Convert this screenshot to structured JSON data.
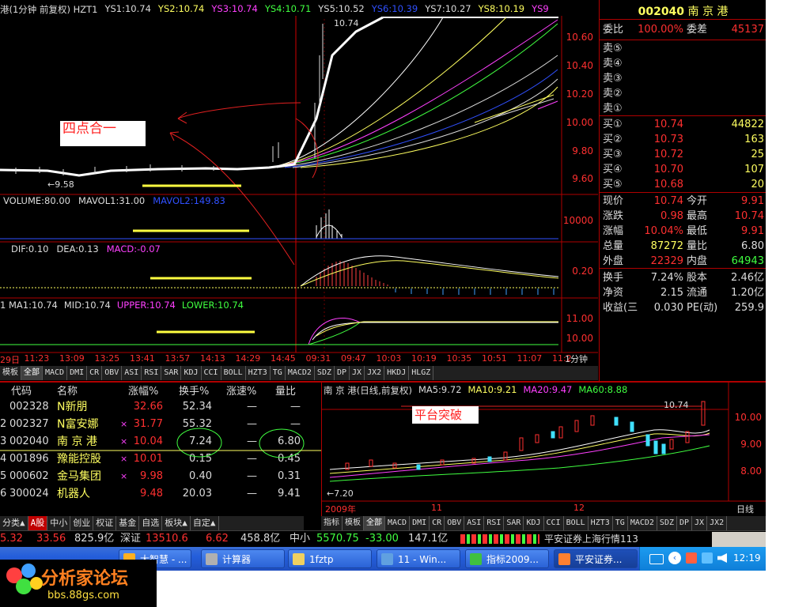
{
  "stock": {
    "code": "002040",
    "name": "南 京 港"
  },
  "intraday": {
    "legend": [
      {
        "text": "港(1分钟 前复权) HZT1",
        "color": "#dcdcdc"
      },
      {
        "text": "YS1:10.74",
        "color": "#dcdcdc"
      },
      {
        "text": "YS2:10.74",
        "color": "#ffff60"
      },
      {
        "text": "YS3:10.74",
        "color": "#ff40ff"
      },
      {
        "text": "YS4:10.71",
        "color": "#40ff40"
      },
      {
        "text": "YS5:10.52",
        "color": "#dcdcdc"
      },
      {
        "text": "YS6:10.39",
        "color": "#3050ff"
      },
      {
        "text": "YS7:10.27",
        "color": "#dcdcdc"
      },
      {
        "text": "YS8:10.19",
        "color": "#ffff60"
      },
      {
        "text": "YS9",
        "color": "#ff40ff"
      }
    ],
    "peak_label": "10.74",
    "low_label": "9.58",
    "annotation": "四点合一",
    "price_axis": [
      "10.60",
      "10.40",
      "10.20",
      "10.00",
      "9.80",
      "9.60"
    ]
  },
  "volume_panel": {
    "legend": [
      {
        "text": "VOLUME:80.00",
        "color": "#dcdcdc"
      },
      {
        "text": "MAVOL1:31.00",
        "color": "#dcdcdc"
      },
      {
        "text": "MAVOL2:149.83",
        "color": "#3050ff"
      }
    ],
    "axis": [
      "10000"
    ]
  },
  "macd_panel": {
    "legend": [
      {
        "text": "DIF:0.10",
        "color": "#dcdcdc"
      },
      {
        "text": "DEA:0.13",
        "color": "#dcdcdc"
      },
      {
        "text": "MACD:-0.07",
        "color": "#ff40ff"
      }
    ],
    "axis": [
      "0.20"
    ]
  },
  "boll_panel": {
    "legend": [
      {
        "text": "1 MA1:10.74",
        "color": "#dcdcdc"
      },
      {
        "text": "MID:10.74",
        "color": "#dcdcdc"
      },
      {
        "text": "UPPER:10.74",
        "color": "#ff40ff"
      },
      {
        "text": "LOWER:10.74",
        "color": "#40ff40"
      }
    ],
    "axis": [
      "11.00",
      "10.00"
    ]
  },
  "time_axis": {
    "labels": [
      "29日",
      "11:23",
      "13:09",
      "13:25",
      "13:41",
      "13:57",
      "14:13",
      "14:29",
      "14:45",
      "09:31",
      "09:47",
      "10:03",
      "10:19",
      "10:35",
      "10:51",
      "11:07",
      "11:2"
    ],
    "period": "1分钟"
  },
  "indicator_tabs_top": [
    "模板",
    "全部",
    "MACD",
    "DMI",
    "CR",
    "OBV",
    "ASI",
    "RSI",
    "SAR",
    "KDJ",
    "CCI",
    "BOLL",
    "HZT3",
    "TG",
    "MACD2",
    "SDZ",
    "DP",
    "JX",
    "JX2",
    "HKDJ",
    "HLGZ"
  ],
  "order_book": {
    "header_code": "002040",
    "header_name": "南 京 港",
    "ratio_label": "委比",
    "ratio_value": "100.00%",
    "diff_label": "委差",
    "diff_value": "45137",
    "sells": [
      {
        "label": "卖⑤",
        "price": "",
        "vol": ""
      },
      {
        "label": "卖④",
        "price": "",
        "vol": ""
      },
      {
        "label": "卖③",
        "price": "",
        "vol": ""
      },
      {
        "label": "卖②",
        "price": "",
        "vol": ""
      },
      {
        "label": "卖①",
        "price": "",
        "vol": ""
      }
    ],
    "buys": [
      {
        "label": "买①",
        "price": "10.74",
        "vol": "44822"
      },
      {
        "label": "买②",
        "price": "10.73",
        "vol": "163"
      },
      {
        "label": "买③",
        "price": "10.72",
        "vol": "25"
      },
      {
        "label": "买④",
        "price": "10.70",
        "vol": "107"
      },
      {
        "label": "买⑤",
        "price": "10.68",
        "vol": "20"
      }
    ]
  },
  "quote_stats": [
    {
      "l1": "现价",
      "v1": "10.74",
      "c1": "#ff3030",
      "l2": "今开",
      "v2": "9.91",
      "c2": "#ff3030"
    },
    {
      "l1": "涨跌",
      "v1": "0.98",
      "c1": "#ff3030",
      "l2": "最高",
      "v2": "10.74",
      "c2": "#ff3030"
    },
    {
      "l1": "涨幅",
      "v1": "10.04%",
      "c1": "#ff3030",
      "l2": "最低",
      "v2": "9.91",
      "c2": "#ff3030"
    },
    {
      "l1": "总量",
      "v1": "87272",
      "c1": "#ffff60",
      "l2": "量比",
      "v2": "6.80",
      "c2": "#dcdcdc"
    },
    {
      "l1": "外盘",
      "v1": "22329",
      "c1": "#ff3030",
      "l2": "内盘",
      "v2": "64943",
      "c2": "#40ff40"
    },
    {
      "l1": "换手",
      "v1": "7.24%",
      "c1": "#dcdcdc",
      "l2": "股本",
      "v2": "2.46亿",
      "c2": "#dcdcdc"
    },
    {
      "l1": "净资",
      "v1": "2.15",
      "c1": "#dcdcdc",
      "l2": "流通",
      "v2": "1.20亿",
      "c2": "#dcdcdc"
    },
    {
      "l1": "收益(三",
      "v1": "0.030",
      "c1": "#dcdcdc",
      "l2": "PE(动)",
      "v2": "259.9",
      "c2": "#dcdcdc"
    }
  ],
  "watchlist": {
    "headers": [
      "代码",
      "名称",
      "涨幅%",
      "换手%",
      "涨速%",
      "量比"
    ],
    "rows": [
      {
        "idx": "",
        "code": "002328",
        "name": "N新朋",
        "mark": "",
        "chg": "32.66",
        "turnover": "52.34",
        "speed": "—",
        "ratio": "—"
      },
      {
        "idx": "2",
        "code": "002327",
        "name": "N富安娜",
        "mark": "×",
        "chg": "31.77",
        "turnover": "55.32",
        "speed": "—",
        "ratio": "—"
      },
      {
        "idx": "3",
        "code": "002040",
        "name": "南 京 港",
        "mark": "×",
        "chg": "10.04",
        "turnover": "7.24",
        "speed": "—",
        "ratio": "6.80"
      },
      {
        "idx": "4",
        "code": "001896",
        "name": "豫能控股",
        "mark": "×",
        "chg": "10.01",
        "turnover": "0.15",
        "speed": "—",
        "ratio": "0.45"
      },
      {
        "idx": "5",
        "code": "000602",
        "name": "金马集团",
        "mark": "×",
        "chg": "9.98",
        "turnover": "0.40",
        "speed": "—",
        "ratio": "0.31"
      },
      {
        "idx": "6",
        "code": "300024",
        "name": "机器人",
        "mark": "",
        "chg": "9.48",
        "turnover": "20.03",
        "speed": "—",
        "ratio": "9.41"
      }
    ],
    "bottom_tabs": [
      "分类▲",
      "A股",
      "中小",
      "创业",
      "权证",
      "基金",
      "自选",
      "板块▲",
      "自定▲"
    ]
  },
  "daily_chart": {
    "legend": [
      {
        "text": "南 京 港(日线,前复权)",
        "color": "#dcdcdc"
      },
      {
        "text": "MA5:9.72",
        "color": "#dcdcdc"
      },
      {
        "text": "MA10:9.21",
        "color": "#ffff60"
      },
      {
        "text": "MA20:9.47",
        "color": "#ff40ff"
      },
      {
        "text": "MA60:8.88",
        "color": "#40ff40"
      }
    ],
    "annotation": "平台突破",
    "high_label": "10.74",
    "low_label": "7.20",
    "axis": [
      "10.00",
      "9.00",
      "8.00"
    ],
    "date_labels": [
      "2009年",
      "11",
      "12"
    ],
    "period": "日线",
    "tabs": [
      "指标",
      "模板",
      "全部",
      "MACD",
      "DMI",
      "CR",
      "OBV",
      "ASI",
      "RSI",
      "SAR",
      "KDJ",
      "CCI",
      "BOLL",
      "HZT3",
      "TG",
      "MACD2",
      "SDZ",
      "DP",
      "JX",
      "JX2"
    ]
  },
  "status_bar": {
    "seg1_a": "5.32",
    "seg1_b": "33.56",
    "seg1_c": "825.9亿",
    "sz_label": "深证",
    "sz_value": "13510.6",
    "sz_change": "6.62",
    "sz_amount": "458.8亿",
    "zx_label": "中小",
    "zx_value": "5570.75",
    "zx_change": "-33.00",
    "zx_amount": "147.1亿",
    "broker": "平安证券上海行情113"
  },
  "taskbar": {
    "items": [
      {
        "label": "计算器",
        "icon": "calculator-icon"
      },
      {
        "label": "1fztp",
        "icon": "folder-icon"
      },
      {
        "label": "11 - Win...",
        "icon": "image-viewer-icon"
      },
      {
        "label": "指标2009...",
        "icon": "browser-icon"
      },
      {
        "label": "平安证券...",
        "icon": "trading-app-icon"
      }
    ],
    "partial_item": "大智慧 - ...",
    "clock": "12:19"
  },
  "watermark": {
    "title": "分析家论坛",
    "url": "bbs.88gs.com"
  }
}
